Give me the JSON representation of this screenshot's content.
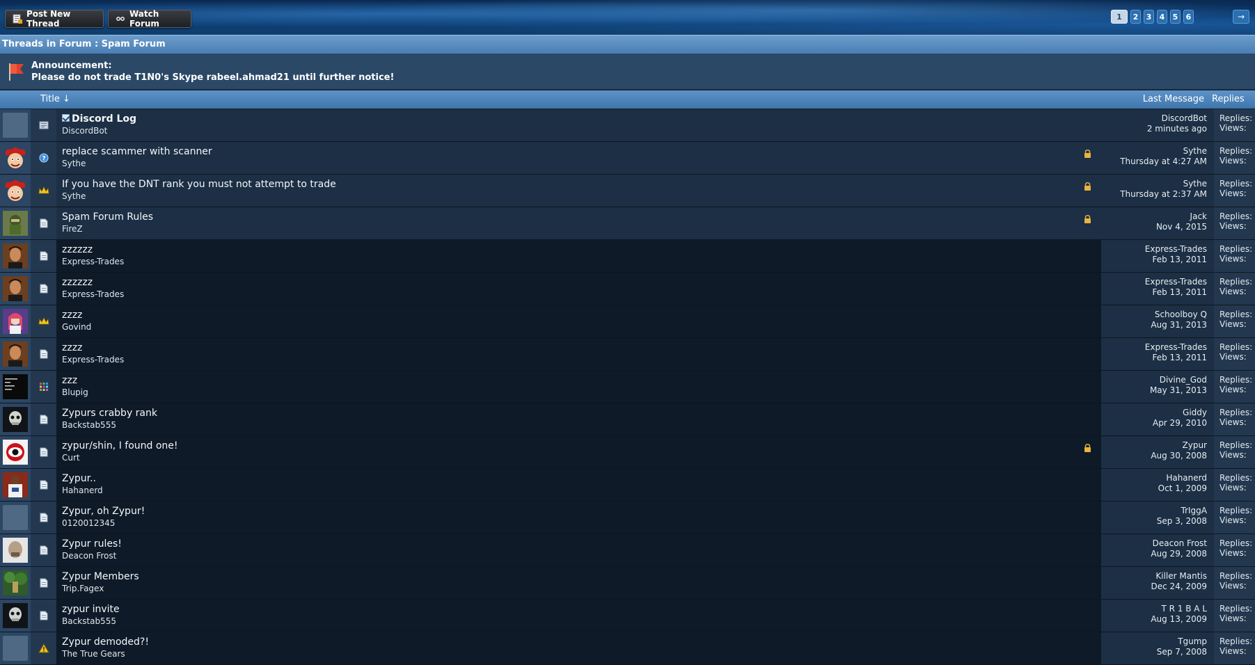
{
  "toolbar": {
    "post_new_thread": "Post New Thread",
    "watch_forum": "Watch Forum"
  },
  "pagination": {
    "pages": [
      "1",
      "2",
      "3",
      "4",
      "5",
      "6"
    ],
    "current": "1",
    "next": "→"
  },
  "forum": {
    "header": "Threads in Forum : Spam Forum"
  },
  "announcement": {
    "label": "Announcement:",
    "text": "Please do not trade T1N0's Skype rabeel.ahmad21 until further notice!"
  },
  "columns": {
    "title": "Title ↓",
    "last_message": "Last Message",
    "replies": "Replies"
  },
  "stats_labels": {
    "replies": "Replies:",
    "views": "Views:"
  },
  "threads": [
    {
      "title": "Discord Log",
      "author": "DiscordBot",
      "last_user": "DiscordBot",
      "last_time": "2 minutes ago",
      "icon": "document-icon",
      "avatar": "blank",
      "sticky": true,
      "locked": false,
      "checked": true
    },
    {
      "title": "replace scammer with scanner",
      "author": "Sythe",
      "last_user": "Sythe",
      "last_time": "Thursday at 4:27 AM",
      "icon": "question-icon",
      "avatar": "jester",
      "sticky": true,
      "locked": true
    },
    {
      "title": "If you have the DNT rank you must not attempt to trade",
      "author": "Sythe",
      "last_user": "Sythe",
      "last_time": "Thursday at 2:37 AM",
      "icon": "crown-icon",
      "avatar": "jester",
      "sticky": true,
      "locked": true
    },
    {
      "title": "Spam Forum Rules",
      "author": "FireZ",
      "last_user": "Jack",
      "last_time": "Nov 4, 2015",
      "icon": "page-icon",
      "avatar": "soldier",
      "sticky": true,
      "locked": true
    },
    {
      "title": "zzzzzz",
      "author": "Express-Trades",
      "last_user": "Express-Trades",
      "last_time": "Feb 13, 2011",
      "icon": "page-icon",
      "avatar": "man",
      "sticky": false,
      "locked": false
    },
    {
      "title": "zzzzzz",
      "author": "Express-Trades",
      "last_user": "Express-Trades",
      "last_time": "Feb 13, 2011",
      "icon": "page-icon",
      "avatar": "man",
      "sticky": false,
      "locked": false
    },
    {
      "title": "zzzz",
      "author": "Govind",
      "last_user": "Schoolboy Q",
      "last_time": "Aug 31, 2013",
      "icon": "crown-icon",
      "avatar": "anime",
      "sticky": false,
      "locked": false
    },
    {
      "title": "zzzz",
      "author": "Express-Trades",
      "last_user": "Express-Trades",
      "last_time": "Feb 13, 2011",
      "icon": "page-icon",
      "avatar": "man",
      "sticky": false,
      "locked": false
    },
    {
      "title": "zzz",
      "author": "Blupig",
      "last_user": "Divine_God",
      "last_time": "May 31, 2013",
      "icon": "grid-icon",
      "avatar": "dark-text",
      "sticky": false,
      "locked": false
    },
    {
      "title": "Zypurs crabby rank",
      "author": "Backstab555",
      "last_user": "Giddy",
      "last_time": "Apr 29, 2010",
      "icon": "page-icon",
      "avatar": "skull",
      "sticky": false,
      "locked": false
    },
    {
      "title": "zypur/shin, I found one!",
      "author": "Curt",
      "last_user": "Zypur",
      "last_time": "Aug 30, 2008",
      "icon": "page-icon",
      "avatar": "eye",
      "sticky": false,
      "locked": true
    },
    {
      "title": "Zypur..",
      "author": "Hahanerd",
      "last_user": "Hahanerd",
      "last_time": "Oct 1, 2009",
      "icon": "page-icon",
      "avatar": "player",
      "sticky": false,
      "locked": false
    },
    {
      "title": "Zypur, oh Zypur!",
      "author": "0120012345",
      "last_user": "TrIggA",
      "last_time": "Sep 3, 2008",
      "icon": "page-icon",
      "avatar": "blank",
      "sticky": false,
      "locked": false
    },
    {
      "title": "Zypur rules!",
      "author": "Deacon Frost",
      "last_user": "Deacon Frost",
      "last_time": "Aug 29, 2008",
      "icon": "page-icon",
      "avatar": "bald",
      "sticky": false,
      "locked": false
    },
    {
      "title": "Zypur Members",
      "author": "Trip.Fagex",
      "last_user": "Killer Mantis",
      "last_time": "Dec 24, 2009",
      "icon": "page-icon",
      "avatar": "forest",
      "sticky": false,
      "locked": false
    },
    {
      "title": "zypur invite",
      "author": "Backstab555",
      "last_user": "T R 1 B A L",
      "last_time": "Aug 13, 2009",
      "icon": "page-icon",
      "avatar": "skull",
      "sticky": false,
      "locked": false
    },
    {
      "title": "Zypur demoded?!",
      "author": "The True Gears",
      "last_user": "Tgump",
      "last_time": "Sep 7, 2008",
      "icon": "warning-icon",
      "avatar": "blank",
      "sticky": false,
      "locked": false
    }
  ]
}
